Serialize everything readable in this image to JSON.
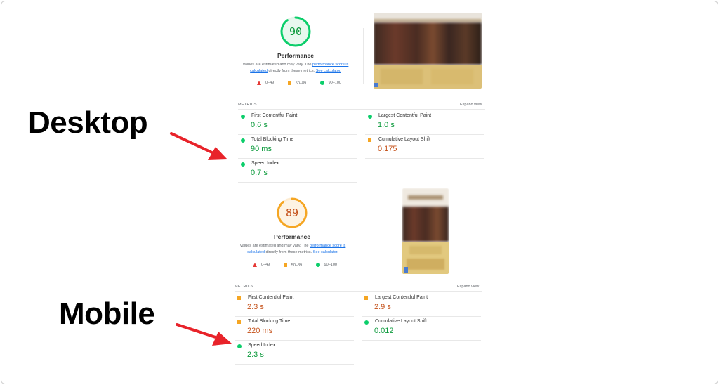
{
  "colors": {
    "good": "#0cce6b",
    "average": "#f5a623",
    "poor": "#e53935",
    "arrow": "#e8232a"
  },
  "desktop": {
    "label": "Desktop",
    "score": "90",
    "score_value": 90,
    "score_color": "#0cce6b",
    "perf_title": "Performance",
    "note": {
      "pre": "Values are estimated and may vary. The ",
      "link1": "performance score is calculated",
      "mid": " directly from these metrics. ",
      "link2": "See calculator."
    },
    "legend": {
      "poor": "0–49",
      "average": "50–89",
      "good": "90–100"
    },
    "metrics_label": "METRICS",
    "expand": "Expand view",
    "metrics": [
      {
        "name": "First Contentful Paint",
        "value": "0.6 s",
        "status": "good"
      },
      {
        "name": "Largest Contentful Paint",
        "value": "1.0 s",
        "status": "good"
      },
      {
        "name": "Total Blocking Time",
        "value": "90 ms",
        "status": "good"
      },
      {
        "name": "Cumulative Layout Shift",
        "value": "0.175",
        "status": "average"
      },
      {
        "name": "Speed Index",
        "value": "0.7 s",
        "status": "good"
      }
    ]
  },
  "mobile": {
    "label": "Mobile",
    "score": "89",
    "score_value": 89,
    "score_color": "#f5a623",
    "perf_title": "Performance",
    "note": {
      "pre": "Values are estimated and may vary. The ",
      "link1": "performance score is calculated",
      "mid": " directly from these metrics. ",
      "link2": "See calculator."
    },
    "legend": {
      "poor": "0–49",
      "average": "50–89",
      "good": "90–100"
    },
    "metrics_label": "METRICS",
    "expand": "Expand view",
    "metrics": [
      {
        "name": "First Contentful Paint",
        "value": "2.3 s",
        "status": "average"
      },
      {
        "name": "Largest Contentful Paint",
        "value": "2.9 s",
        "status": "average"
      },
      {
        "name": "Total Blocking Time",
        "value": "220 ms",
        "status": "average"
      },
      {
        "name": "Cumulative Layout Shift",
        "value": "0.012",
        "status": "good"
      },
      {
        "name": "Speed Index",
        "value": "2.3 s",
        "status": "good"
      }
    ]
  }
}
